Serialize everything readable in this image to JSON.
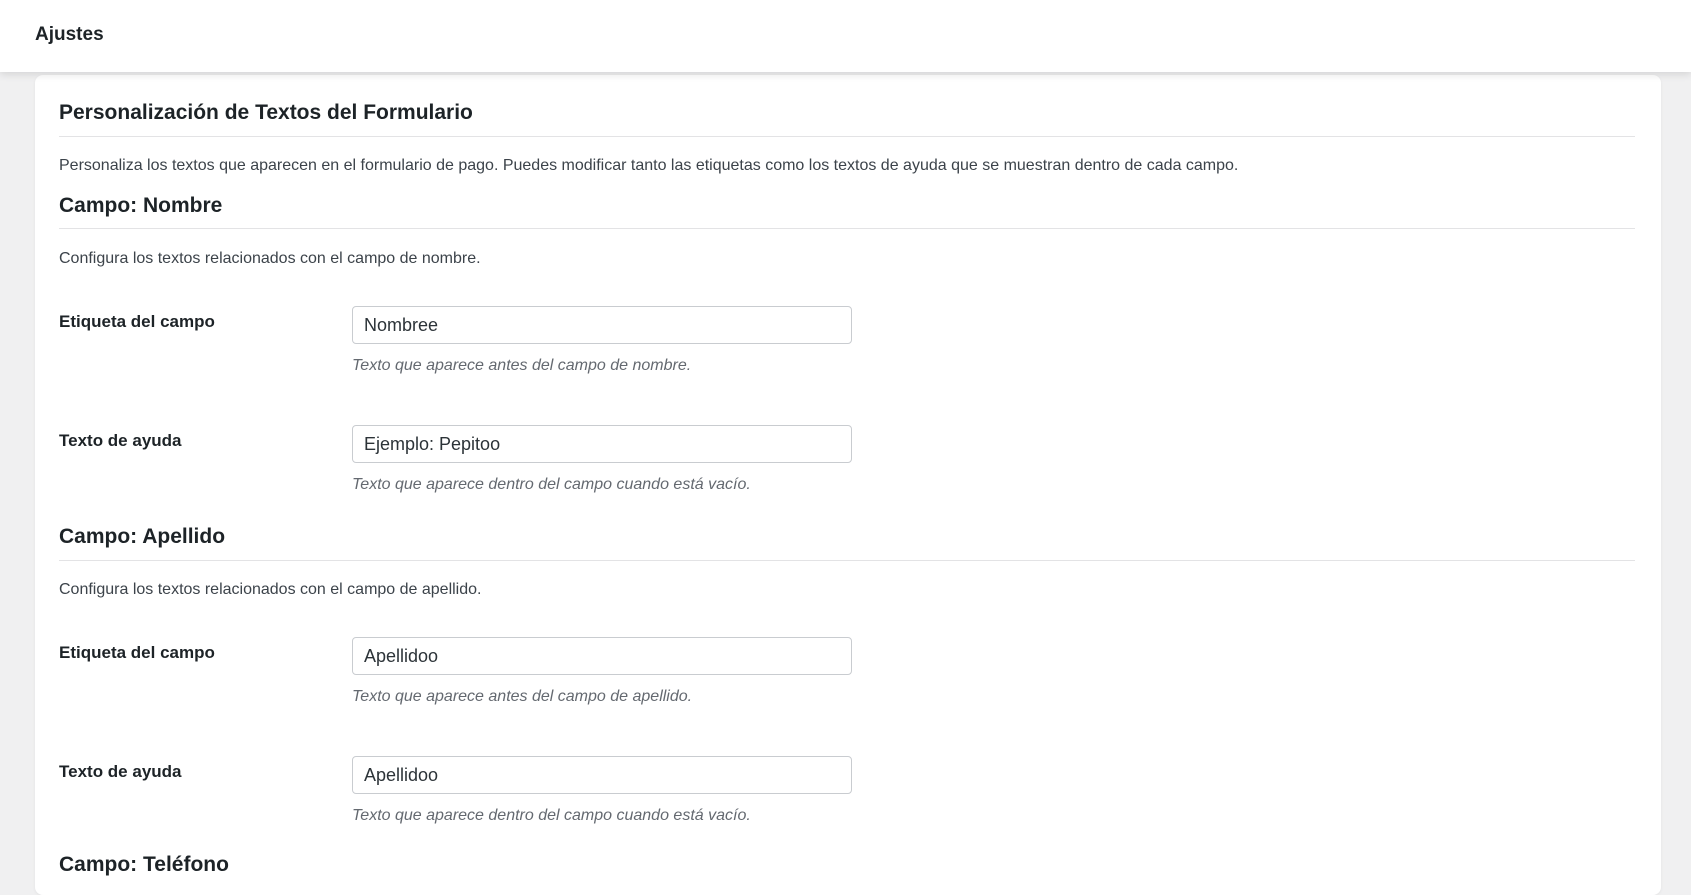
{
  "header": {
    "title": "Ajustes"
  },
  "page": {
    "title": "Personalización de Textos del Formulario",
    "description": "Personaliza los textos que aparecen en el formulario de pago. Puedes modificar tanto las etiquetas como los textos de ayuda que se muestran dentro de cada campo."
  },
  "sections": [
    {
      "title": "Campo: Nombre",
      "description": "Configura los textos relacionados con el campo de nombre.",
      "label_field": {
        "label": "Etiqueta del campo",
        "value": "Nombree",
        "hint": "Texto que aparece antes del campo de nombre."
      },
      "help_field": {
        "label": "Texto de ayuda",
        "value": "Ejemplo: Pepitoo",
        "hint": "Texto que aparece dentro del campo cuando está vacío."
      }
    },
    {
      "title": "Campo: Apellido",
      "description": "Configura los textos relacionados con el campo de apellido.",
      "label_field": {
        "label": "Etiqueta del campo",
        "value": "Apellidoo",
        "hint": "Texto que aparece antes del campo de apellido."
      },
      "help_field": {
        "label": "Texto de ayuda",
        "value": "Apellidoo",
        "hint": "Texto que aparece dentro del campo cuando está vacío."
      }
    },
    {
      "title": "Campo: Teléfono"
    }
  ]
}
